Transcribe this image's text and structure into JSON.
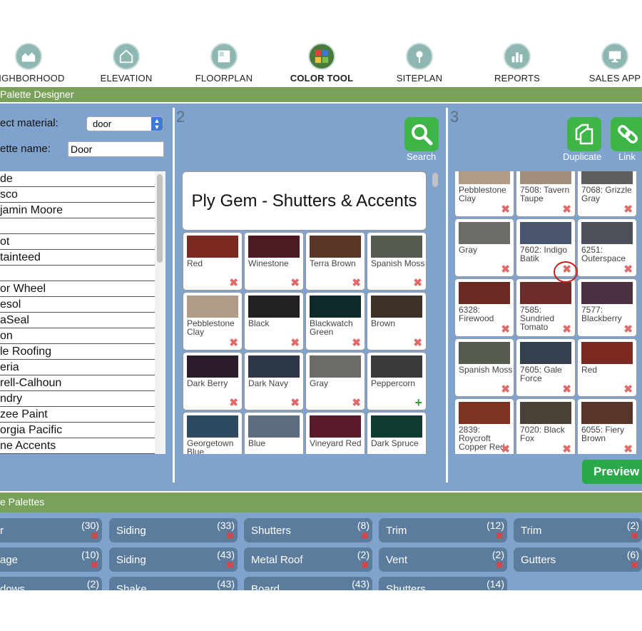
{
  "nav": [
    {
      "label": "EIGHBORHOOD",
      "icon": "houses-icon",
      "active": false
    },
    {
      "label": "ELEVATION",
      "icon": "house-icon",
      "active": false
    },
    {
      "label": "FLOORPLAN",
      "icon": "floorplan-icon",
      "active": false
    },
    {
      "label": "COLOR TOOL",
      "icon": "color-grid-icon",
      "active": true
    },
    {
      "label": "SITEPLAN",
      "icon": "map-pin-icon",
      "active": false
    },
    {
      "label": "REPORTS",
      "icon": "bar-chart-icon",
      "active": false
    },
    {
      "label": "SALES APP",
      "icon": "monitor-icon",
      "active": false
    }
  ],
  "designer_title": "Palette Designer",
  "section1": {
    "material_label": "ect material:",
    "material_value": "door",
    "palette_name_label": "ette name:",
    "palette_name_value": "Door",
    "brands": [
      "de",
      "sco",
      "jamin Moore",
      "",
      "ot",
      "tainteed",
      "",
      "or Wheel",
      "esol",
      "aSeal",
      "on",
      "le Roofing",
      "eria",
      "rell-Calhoun",
      "ndry",
      "zee Paint",
      "orgia Pacific",
      "ne Accents"
    ]
  },
  "section2": {
    "number": "2",
    "search_label": "Search",
    "palette_title": "Ply Gem - Shutters & Accents",
    "swatches": [
      {
        "name": "Red",
        "color": "#7d2a22",
        "action": "remove"
      },
      {
        "name": "Winestone",
        "color": "#4c1a22",
        "action": "remove"
      },
      {
        "name": "Terra Brown",
        "color": "#5a3424",
        "action": "remove"
      },
      {
        "name": "Spanish Moss",
        "color": "#555b4e",
        "action": "remove"
      },
      {
        "name": "Pebblestone Clay",
        "color": "#b09c86",
        "action": "remove"
      },
      {
        "name": "Black",
        "color": "#222020",
        "action": "remove"
      },
      {
        "name": "Blackwatch Green",
        "color": "#0e2a28",
        "action": "remove"
      },
      {
        "name": "Brown",
        "color": "#3c3028",
        "action": "remove"
      },
      {
        "name": "Dark Berry",
        "color": "#2a1c28",
        "action": "remove"
      },
      {
        "name": "Dark Navy",
        "color": "#2c3848",
        "action": "remove"
      },
      {
        "name": "Gray",
        "color": "#6a6c66",
        "action": "remove"
      },
      {
        "name": "Peppercorn",
        "color": "#3a3a3a",
        "action": "add"
      },
      {
        "name": "Georgetown Blue",
        "color": "#2c4a60",
        "action": "none"
      },
      {
        "name": "Blue",
        "color": "#5e6c80",
        "action": "none"
      },
      {
        "name": "Vineyard Red",
        "color": "#5a1c2a",
        "action": "none"
      },
      {
        "name": "Dark Spruce",
        "color": "#0e3a30",
        "action": "none"
      }
    ]
  },
  "section3": {
    "number": "3",
    "duplicate_label": "Duplicate",
    "link_label": "Link",
    "swatches": [
      {
        "name": "Pebblestone Clay",
        "color": "#b09c86"
      },
      {
        "name": "7508: Tavern Taupe",
        "color": "#a18e7c"
      },
      {
        "name": "7068: Grizzle Gray",
        "color": "#5e5e5c"
      },
      {
        "name": "Gray",
        "color": "#6a6c66"
      },
      {
        "name": "7602: Indigo Batik",
        "color": "#4a5670"
      },
      {
        "name": "6251: Outerspace",
        "color": "#4c5058"
      },
      {
        "name": "6328: Firewood",
        "color": "#6a2a22"
      },
      {
        "name": "7585: Sundried Tomato",
        "color": "#6c2c2a"
      },
      {
        "name": "7577: Blackberry",
        "color": "#4a3040"
      },
      {
        "name": "Spanish Moss",
        "color": "#555b4e"
      },
      {
        "name": "7605: Gale Force",
        "color": "#34404e"
      },
      {
        "name": "Red",
        "color": "#7d2a22"
      },
      {
        "name": "2839: Roycroft Copper Red",
        "color": "#7e3222"
      },
      {
        "name": "7020: Black Fox",
        "color": "#4a4238"
      },
      {
        "name": "6055: Fiery Brown",
        "color": "#5a3428"
      }
    ],
    "preview_label": "Preview"
  },
  "saved": {
    "title": "e Palettes",
    "items": [
      {
        "label": "r",
        "count": "(30)"
      },
      {
        "label": "Siding",
        "count": "(33)"
      },
      {
        "label": "Shutters",
        "count": "(8)"
      },
      {
        "label": "Trim",
        "count": "(12)"
      },
      {
        "label": "Trim",
        "count": "(2)"
      },
      {
        "label": "age",
        "count": "(10)"
      },
      {
        "label": "Siding",
        "count": "(43)"
      },
      {
        "label": "Metal Roof",
        "count": "(2)"
      },
      {
        "label": "Vent",
        "count": "(2)"
      },
      {
        "label": "Gutters",
        "count": "(6)"
      },
      {
        "label": "dows",
        "count": "(2)"
      },
      {
        "label": "Shake",
        "count": "(43)"
      },
      {
        "label": "Board",
        "count": "(43)"
      },
      {
        "label": "Shutters",
        "count": "(14)"
      }
    ]
  }
}
